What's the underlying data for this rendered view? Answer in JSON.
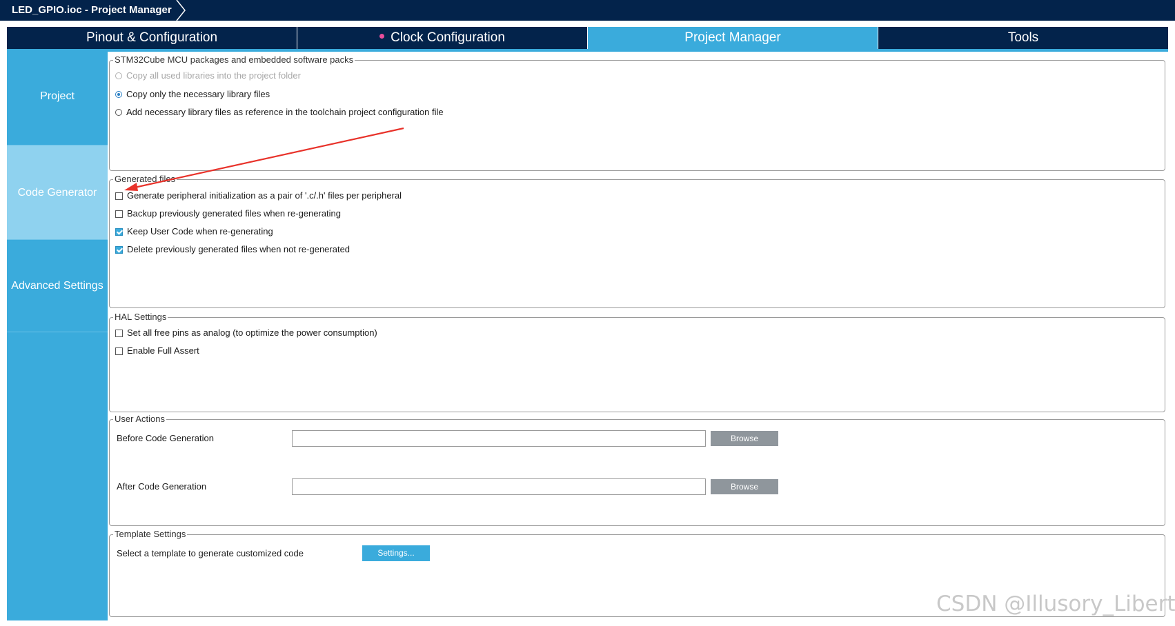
{
  "window": {
    "breadcrumb": "LED_GPIO.ioc - Project Manager"
  },
  "tabs": [
    {
      "label": "Pinout & Configuration",
      "active": false,
      "indicator": false
    },
    {
      "label": "Clock Configuration",
      "active": false,
      "indicator": true
    },
    {
      "label": "Project Manager",
      "active": true,
      "indicator": false
    },
    {
      "label": "Tools",
      "active": false,
      "indicator": false
    }
  ],
  "sidebar": {
    "items": [
      {
        "label": "Project",
        "active": false
      },
      {
        "label": "Code Generator",
        "active": true
      },
      {
        "label": "Advanced Settings",
        "active": false
      }
    ]
  },
  "packages": {
    "title": "STM32Cube MCU packages and embedded software packs",
    "options": [
      {
        "label": "Copy all used libraries into the project folder",
        "selected": false,
        "disabled": true
      },
      {
        "label": "Copy only the necessary library files",
        "selected": true,
        "disabled": false
      },
      {
        "label": "Add necessary library files as reference in the toolchain project configuration file",
        "selected": false,
        "disabled": false
      }
    ]
  },
  "generated_files": {
    "title": "Generated files",
    "options": [
      {
        "label": "Generate peripheral initialization as a pair of '.c/.h' files per peripheral",
        "checked": false
      },
      {
        "label": "Backup previously generated files when re-generating",
        "checked": false
      },
      {
        "label": "Keep User Code when re-generating",
        "checked": true
      },
      {
        "label": "Delete previously generated files when not re-generated",
        "checked": true
      }
    ]
  },
  "hal_settings": {
    "title": "HAL Settings",
    "options": [
      {
        "label": "Set all free pins as analog (to optimize the power consumption)",
        "checked": false
      },
      {
        "label": "Enable Full Assert",
        "checked": false
      }
    ]
  },
  "user_actions": {
    "title": "User Actions",
    "before_label": "Before Code Generation",
    "before_value": "",
    "after_label": "After Code Generation",
    "after_value": "",
    "browse_label": "Browse"
  },
  "template_settings": {
    "title": "Template Settings",
    "label": "Select a template to generate customized code",
    "button_label": "Settings..."
  },
  "watermark": "CSDN @Illusory_Liberty",
  "colors": {
    "navy": "#03234b",
    "accent": "#3aabdc",
    "sidebar_active": "#8fd2ef",
    "annotation_arrow": "#e8322a"
  }
}
